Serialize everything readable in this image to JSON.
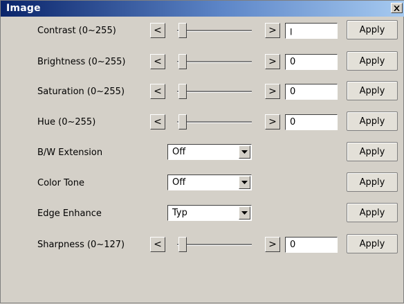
{
  "window": {
    "title": "Image",
    "close_label": "×"
  },
  "controls": [
    {
      "label": "Contrast (0~255)",
      "type": "slider",
      "dec": "<",
      "inc": ">",
      "value": "ן",
      "level": 0,
      "apply": "Apply"
    },
    {
      "label": "Brightness (0~255)",
      "type": "slider",
      "dec": "<",
      "inc": ">",
      "value": "0",
      "level": 0,
      "apply": "Apply"
    },
    {
      "label": "Saturation (0~255)",
      "type": "slider",
      "dec": "<",
      "inc": ">",
      "value": "0",
      "level": 0,
      "apply": "Apply"
    },
    {
      "label": "Hue (0~255)",
      "type": "slider",
      "dec": "<",
      "inc": ">",
      "value": "0",
      "level": 0,
      "apply": "Apply"
    },
    {
      "label": "B/W Extension",
      "type": "combo",
      "value": "Off",
      "apply": "Apply"
    },
    {
      "label": "Color Tone",
      "type": "combo",
      "value": "Off",
      "apply": "Apply"
    },
    {
      "label": "Edge Enhance",
      "type": "combo",
      "value": "Typ",
      "apply": "Apply"
    },
    {
      "label": "Sharpness (0~127)",
      "type": "slider",
      "dec": "<",
      "inc": ">",
      "value": "0",
      "level": 0,
      "apply": "Apply"
    }
  ],
  "icons": {
    "close": "close-icon",
    "dropdown": "chevron-down-icon"
  }
}
